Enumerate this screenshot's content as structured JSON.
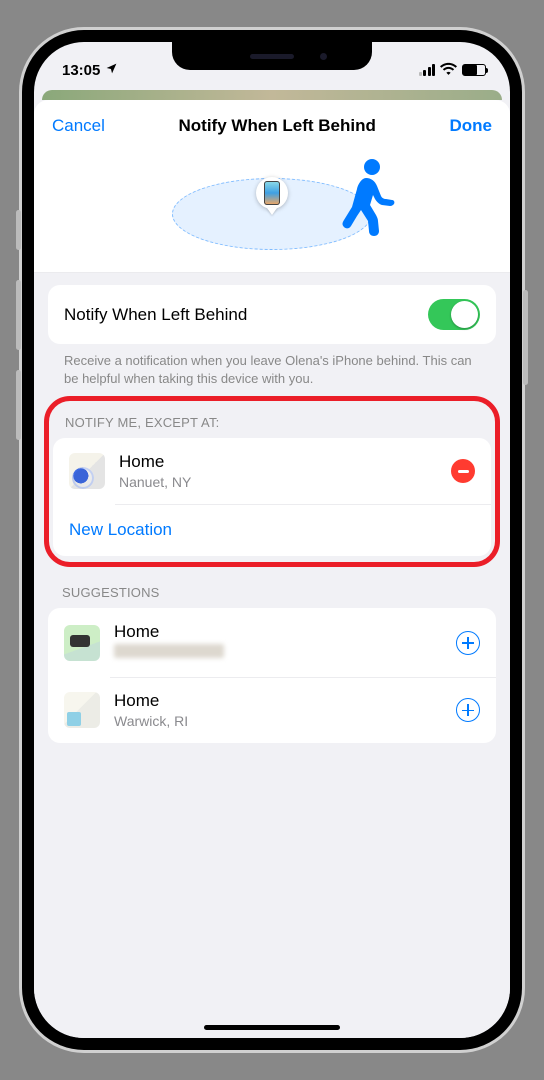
{
  "status": {
    "time": "13:05"
  },
  "header": {
    "cancel": "Cancel",
    "title": "Notify When Left Behind",
    "done": "Done"
  },
  "toggle_section": {
    "label": "Notify When Left Behind",
    "footer": "Receive a notification when you leave Olena's iPhone behind. This can be helpful when taking this device with you."
  },
  "except_at": {
    "header": "Notify Me, Except At:",
    "items": [
      {
        "title": "Home",
        "subtitle": "Nanuet, NY"
      }
    ],
    "new_location": "New Location"
  },
  "suggestions": {
    "header": "Suggestions",
    "items": [
      {
        "title": "Home",
        "subtitle": ""
      },
      {
        "title": "Home",
        "subtitle": "Warwick, RI"
      }
    ]
  },
  "colors": {
    "accent": "#007aff",
    "danger": "#ff3b30",
    "toggle_on": "#34c759",
    "highlight": "#eb1e28"
  }
}
